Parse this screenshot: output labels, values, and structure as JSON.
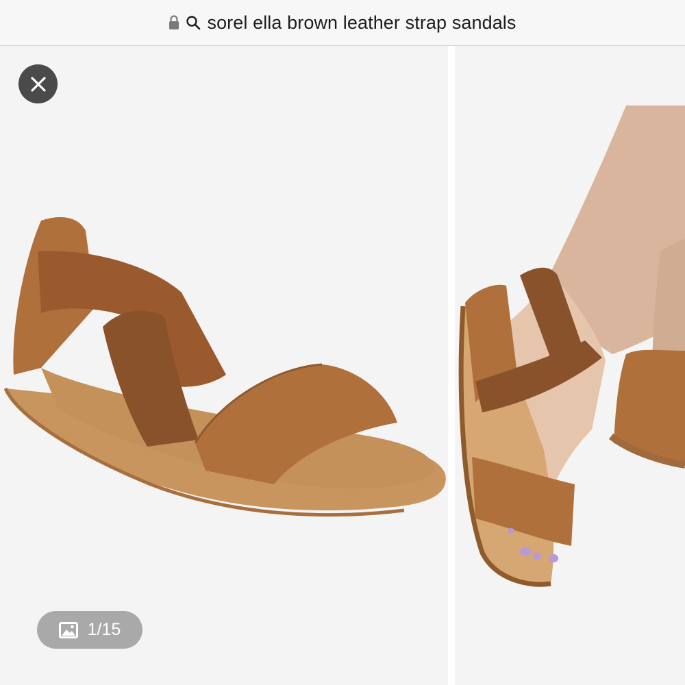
{
  "address_bar": {
    "lock_icon": "lock-icon",
    "search_icon": "search-icon",
    "query": "sorel ella brown leather strap sandals"
  },
  "gallery": {
    "close_icon": "close-icon",
    "counter_icon": "image-icon",
    "counter_text": "1/15",
    "images": [
      {
        "subject": "brown leather sandal product photo"
      },
      {
        "subject": "sandal worn on foot"
      }
    ]
  },
  "colors": {
    "sandal_tan": "#b0703c",
    "strap_brown": "#8a522a",
    "sole": "#c9955f",
    "background": "#f4f4f4"
  }
}
